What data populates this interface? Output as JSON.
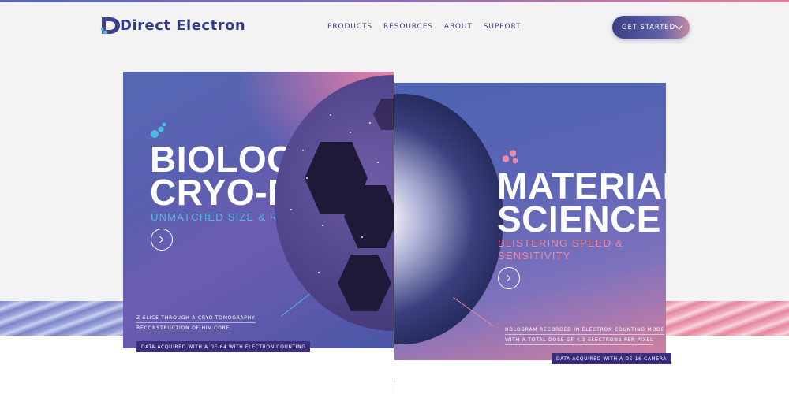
{
  "brand": {
    "name": "Direct Electron",
    "logo_initial": "D"
  },
  "nav": {
    "items": [
      "PRODUCTS",
      "RESOURCES",
      "ABOUT",
      "SUPPORT"
    ]
  },
  "cta": {
    "label": "GET STARTED",
    "icon": "chevron-down-icon"
  },
  "cards": {
    "bio": {
      "title_line1": "BIOLOGICAL",
      "title_line2": "CRYO-EM",
      "subtitle": "UNMATCHED SIZE & RESOLUTION",
      "caption_line1": "Z-SLICE THROUGH A CRYO-TOMOGRAPHY",
      "caption_line2": "RECONSTRUCTION OF HIV CORE",
      "tag": "DATA ACQUIRED WITH A DE-64 WITH ELECTRON COUNTING",
      "accent_color": "#4fb8e6",
      "icon": "bubbles-icon"
    },
    "mat": {
      "title_line1": "MATERIAL",
      "title_line2": "SCIENCE",
      "subtitle_line1": "BLISTERING SPEED &",
      "subtitle_line2": "SENSITIVITY",
      "caption_line1": "HOLOGRAM RECORDED IN ELECTRON COUNTING MODE",
      "caption_line2": "WITH A TOTAL DOSE OF 4.3 ELECTRONS PER PIXEL",
      "tag": "DATA ACQUIRED WITH A DE-16 CAMERA",
      "accent_color": "#e98aa8",
      "icon": "hexagons-icon"
    }
  }
}
